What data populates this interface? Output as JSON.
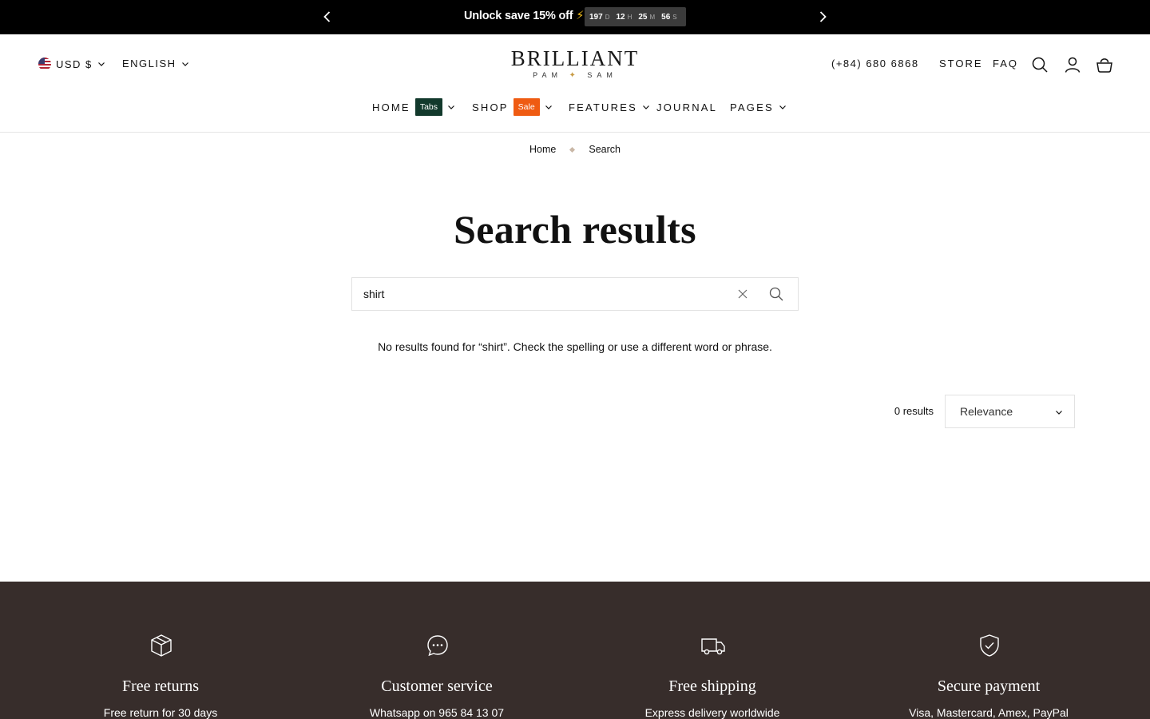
{
  "announcement": {
    "message": "Unlock save 15% off",
    "bolt": "⚡",
    "countdown": [
      {
        "value": "197",
        "unit": "D"
      },
      {
        "value": "12",
        "unit": "H"
      },
      {
        "value": "25",
        "unit": "M"
      },
      {
        "value": "56",
        "unit": "S"
      }
    ]
  },
  "header": {
    "currency": "USD $",
    "language": "ENGLISH",
    "logo_main": "BRILLIANT",
    "logo_sub_left": "PAM",
    "logo_star": "✦",
    "logo_sub_right": "SAM",
    "phone": "(+84) 680 6868",
    "store": "STORE",
    "faq": "FAQ"
  },
  "nav": {
    "home": "HOME",
    "home_badge": "Tabs",
    "shop": "SHOP",
    "shop_badge": "Sale",
    "features": "FEATURES",
    "journal": "JOURNAL",
    "pages": "PAGES"
  },
  "breadcrumb": {
    "home": "Home",
    "current": "Search"
  },
  "main": {
    "title": "Search results",
    "search_value": "shirt",
    "no_results": "No results found for “shirt”. Check the spelling or use a different word or phrase.",
    "results_count": "0 results",
    "sort_selected": "Relevance"
  },
  "features": [
    {
      "icon": "box-icon",
      "title": "Free returns",
      "subtitle": "Free return for 30 days"
    },
    {
      "icon": "chat-icon",
      "title": "Customer service",
      "subtitle": "Whatsapp on 965 84 13 07"
    },
    {
      "icon": "truck-icon",
      "title": "Free shipping",
      "subtitle": "Express delivery worldwide"
    },
    {
      "icon": "shield-check-icon",
      "title": "Secure payment",
      "subtitle": "Visa, Mastercard, Amex, PayPal"
    }
  ],
  "colors": {
    "announcement_bg": "#000000",
    "badge_tabs": "#12392c",
    "badge_sale": "#ef5b12",
    "footer_bg": "#372d2b",
    "accent_gold": "#c89b45"
  }
}
